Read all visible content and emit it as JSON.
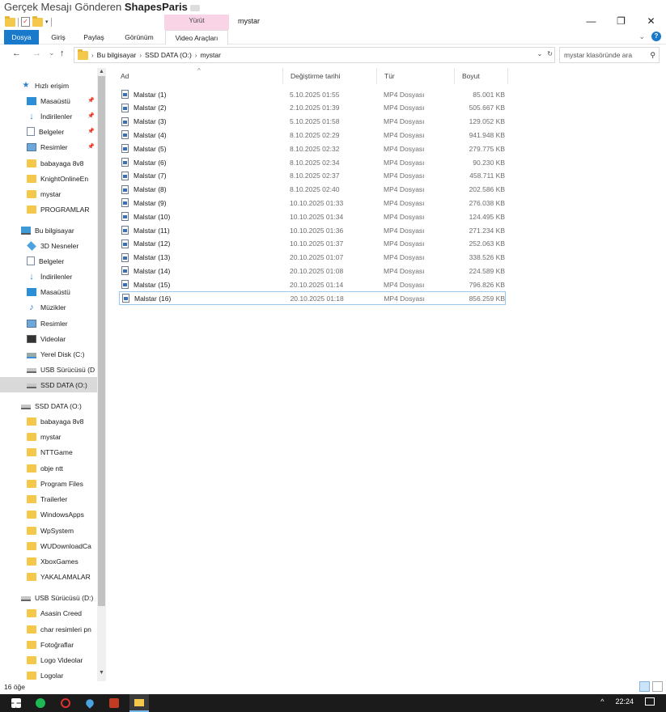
{
  "caption": {
    "text": "Gerçek Mesajı Gönderen ",
    "bold": "ShapesParis"
  },
  "window": {
    "title": "mystar",
    "context_tab_group": "Yürüt"
  },
  "ribbon": {
    "tabs": [
      "Dosya",
      "Giriş",
      "Paylaş",
      "Görünüm",
      "Video Araçları"
    ]
  },
  "nav": {
    "back": "←",
    "forward": "→",
    "recent": "⌄",
    "up": "↑",
    "breadcrumb": [
      "Bu bilgisayar",
      "SSD DATA (O:)",
      "mystar"
    ],
    "search_placeholder": "mystar klasöründe ara"
  },
  "sidebar": {
    "items": [
      {
        "label": "Hızlı erişim",
        "icon": "star-icon"
      },
      {
        "label": "Masaüstü",
        "icon": "desktop-icon",
        "pinned": true
      },
      {
        "label": "İndirilenler",
        "icon": "download-icon",
        "pinned": true
      },
      {
        "label": "Belgeler",
        "icon": "documents-icon",
        "pinned": true
      },
      {
        "label": "Resimler",
        "icon": "pictures-icon",
        "pinned": true
      },
      {
        "label": "babayaga 8v8",
        "icon": "folder-icon"
      },
      {
        "label": "KnightOnlineEn",
        "icon": "folder-icon"
      },
      {
        "label": "mystar",
        "icon": "folder-icon"
      },
      {
        "label": "PROGRAMLAR",
        "icon": "folder-icon"
      },
      {
        "label": "Bu bilgisayar",
        "icon": "computer-icon"
      },
      {
        "label": "3D Nesneler",
        "icon": "3d-objects-icon"
      },
      {
        "label": "Belgeler",
        "icon": "documents-icon"
      },
      {
        "label": "İndirilenler",
        "icon": "download-icon"
      },
      {
        "label": "Masaüstü",
        "icon": "desktop-icon"
      },
      {
        "label": "Müzikler",
        "icon": "music-icon"
      },
      {
        "label": "Resimler",
        "icon": "pictures-icon"
      },
      {
        "label": "Videolar",
        "icon": "videos-icon"
      },
      {
        "label": "Yerel Disk (C:)",
        "icon": "local-disk-icon"
      },
      {
        "label": "USB Sürücüsü (D",
        "icon": "drive-icon"
      },
      {
        "label": "SSD DATA (O:)",
        "icon": "drive-icon",
        "selected": true
      },
      {
        "label": "SSD DATA (O:)",
        "icon": "drive-icon"
      },
      {
        "label": "babayaga 8v8",
        "icon": "folder-icon"
      },
      {
        "label": "mystar",
        "icon": "folder-icon"
      },
      {
        "label": "NTTGame",
        "icon": "folder-icon"
      },
      {
        "label": "obje ntt",
        "icon": "folder-icon"
      },
      {
        "label": "Program Files",
        "icon": "folder-icon"
      },
      {
        "label": "Trailerler",
        "icon": "folder-icon"
      },
      {
        "label": "WindowsApps",
        "icon": "folder-icon"
      },
      {
        "label": "WpSystem",
        "icon": "folder-icon"
      },
      {
        "label": "WUDownloadCa",
        "icon": "folder-icon"
      },
      {
        "label": "XboxGames",
        "icon": "folder-icon"
      },
      {
        "label": "YAKALAMALAR",
        "icon": "folder-icon"
      },
      {
        "label": "USB Sürücüsü (D:)",
        "icon": "drive-icon"
      },
      {
        "label": "Asasin Creed",
        "icon": "folder-icon"
      },
      {
        "label": "char resimleri pn",
        "icon": "folder-icon"
      },
      {
        "label": "Fotoğraflar",
        "icon": "folder-icon"
      },
      {
        "label": "Logo Videolar",
        "icon": "folder-icon"
      },
      {
        "label": "Logolar",
        "icon": "folder-icon"
      }
    ]
  },
  "columns": [
    "Ad",
    "Değiştirme tarihi",
    "Tür",
    "Boyut"
  ],
  "files": [
    {
      "name": "Malstar (1)",
      "date": "5.10.2025 01:55",
      "type": "MP4 Dosyası",
      "size": "85.001 KB"
    },
    {
      "name": "Malstar (2)",
      "date": "2.10.2025 01:39",
      "type": "MP4 Dosyası",
      "size": "505.667 KB"
    },
    {
      "name": "Malstar (3)",
      "date": "5.10.2025 01:58",
      "type": "MP4 Dosyası",
      "size": "129.052 KB"
    },
    {
      "name": "Malstar (4)",
      "date": "8.10.2025 02:29",
      "type": "MP4 Dosyası",
      "size": "941.948 KB"
    },
    {
      "name": "Malstar (5)",
      "date": "8.10.2025 02:32",
      "type": "MP4 Dosyası",
      "size": "279.775 KB"
    },
    {
      "name": "Malstar (6)",
      "date": "8.10.2025 02:34",
      "type": "MP4 Dosyası",
      "size": "90.230 KB"
    },
    {
      "name": "Malstar (7)",
      "date": "8.10.2025 02:37",
      "type": "MP4 Dosyası",
      "size": "458.711 KB"
    },
    {
      "name": "Malstar (8)",
      "date": "8.10.2025 02:40",
      "type": "MP4 Dosyası",
      "size": "202.586 KB"
    },
    {
      "name": "Malstar (9)",
      "date": "10.10.2025 01:33",
      "type": "MP4 Dosyası",
      "size": "276.038 KB"
    },
    {
      "name": "Malstar (10)",
      "date": "10.10.2025 01:34",
      "type": "MP4 Dosyası",
      "size": "124.495 KB"
    },
    {
      "name": "Malstar (11)",
      "date": "10.10.2025 01:36",
      "type": "MP4 Dosyası",
      "size": "271.234 KB"
    },
    {
      "name": "Malstar (12)",
      "date": "10.10.2025 01:37",
      "type": "MP4 Dosyası",
      "size": "252.063 KB"
    },
    {
      "name": "Malstar (13)",
      "date": "20.10.2025 01:07",
      "type": "MP4 Dosyası",
      "size": "338.526 KB"
    },
    {
      "name": "Malstar (14)",
      "date": "20.10.2025 01:08",
      "type": "MP4 Dosyası",
      "size": "224.589 KB"
    },
    {
      "name": "Malstar (15)",
      "date": "20.10.2025 01:14",
      "type": "MP4 Dosyası",
      "size": "796.826 KB"
    },
    {
      "name": "Malstar (16)",
      "date": "20.10.2025 01:18",
      "type": "MP4 Dosyası",
      "size": "856.259 KB",
      "selected": true
    }
  ],
  "status": {
    "count": "16 öğe"
  },
  "taskbar": {
    "time": "22:24",
    "tray_arrow": "^"
  },
  "colors": {
    "accent": "#1979ca",
    "context_tab": "#f9d4e7",
    "selected_border": "#99c9ef",
    "folder": "#f3c84b",
    "taskbar": "#1b1b1b"
  }
}
